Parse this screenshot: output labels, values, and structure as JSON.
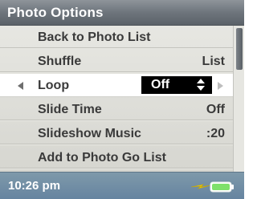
{
  "title_bar": {
    "title": "Photo Options"
  },
  "menu": {
    "items": [
      {
        "label": "Back to Photo List",
        "value": ""
      },
      {
        "label": "Shuffle",
        "value": "List"
      },
      {
        "label": "Loop",
        "value": "Off",
        "selected": true
      },
      {
        "label": "Slide Time",
        "value": "Off"
      },
      {
        "label": "Slideshow Music",
        "value": ":20"
      },
      {
        "label": "Add to Photo Go List",
        "value": ""
      }
    ]
  },
  "status_bar": {
    "time": "10:26 pm",
    "charging_icon": "lightning-bolt-icon",
    "battery_icon": "battery-full-icon",
    "battery_level": 1.0
  },
  "colors": {
    "title_bar": "#6e757c",
    "menu_background": "#dcdcd6",
    "selected_row": "#ffffff",
    "value_box": "#000000",
    "status_bar": "#6f8ca5",
    "charge_bolt": "#f2d20e",
    "battery_fill": "#7fe06b"
  }
}
